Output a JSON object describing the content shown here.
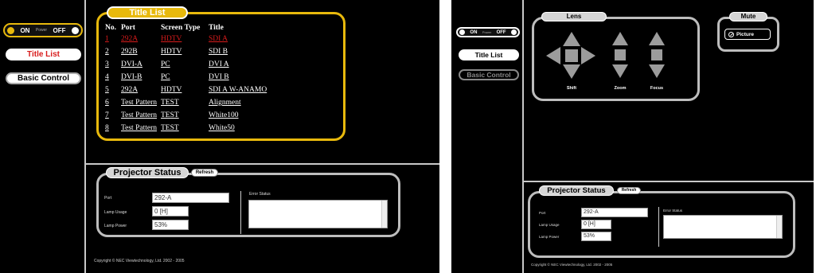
{
  "power": {
    "on_label": "ON",
    "mid_label": "Power",
    "off_label": "OFF"
  },
  "nav": {
    "title_list": "Title List",
    "basic_control": "Basic Control"
  },
  "title_list": {
    "caption": "Title List",
    "headers": {
      "no": "No.",
      "port": "Port",
      "screen_type": "Screen Type",
      "title": "Title"
    },
    "rows": [
      {
        "no": "1",
        "port": "292A",
        "screen_type": "HDTV",
        "title": "SDI A",
        "active": true
      },
      {
        "no": "2",
        "port": "292B",
        "screen_type": "HDTV",
        "title": "SDI B"
      },
      {
        "no": "3",
        "port": "DVI-A",
        "screen_type": "PC",
        "title": "DVI A"
      },
      {
        "no": "4",
        "port": "DVI-B",
        "screen_type": "PC",
        "title": "DVI B"
      },
      {
        "no": "5",
        "port": "292A",
        "screen_type": "HDTV",
        "title": "SDI A W-ANAMO"
      },
      {
        "no": "6",
        "port": "Test Pattern",
        "screen_type": "TEST",
        "title": "Alignment"
      },
      {
        "no": "7",
        "port": "Test Pattern",
        "screen_type": "TEST",
        "title": "White100"
      },
      {
        "no": "8",
        "port": "Test Pattern",
        "screen_type": "TEST",
        "title": "White50"
      }
    ]
  },
  "status": {
    "caption": "Projector Status",
    "refresh_label": "Refresh",
    "port_label": "Port",
    "port_value": "292-A",
    "lamp_usage_label": "Lamp Usage",
    "lamp_usage_value": "0 [H]",
    "lamp_power_label": "Lamp Power",
    "lamp_power_value": "53%",
    "error_label": "Error Status"
  },
  "copyright": "Copyright © NEC Viewtechnology, Ltd. 2002 - 2005",
  "lens": {
    "caption": "Lens",
    "shift": "Shift",
    "zoom": "Zoom",
    "focus": "Focus"
  },
  "mute": {
    "caption": "Mute",
    "picture": "Picture"
  },
  "colors": {
    "accent": "#e8b90c",
    "active_red": "#d81b1b",
    "background": "#000000"
  }
}
